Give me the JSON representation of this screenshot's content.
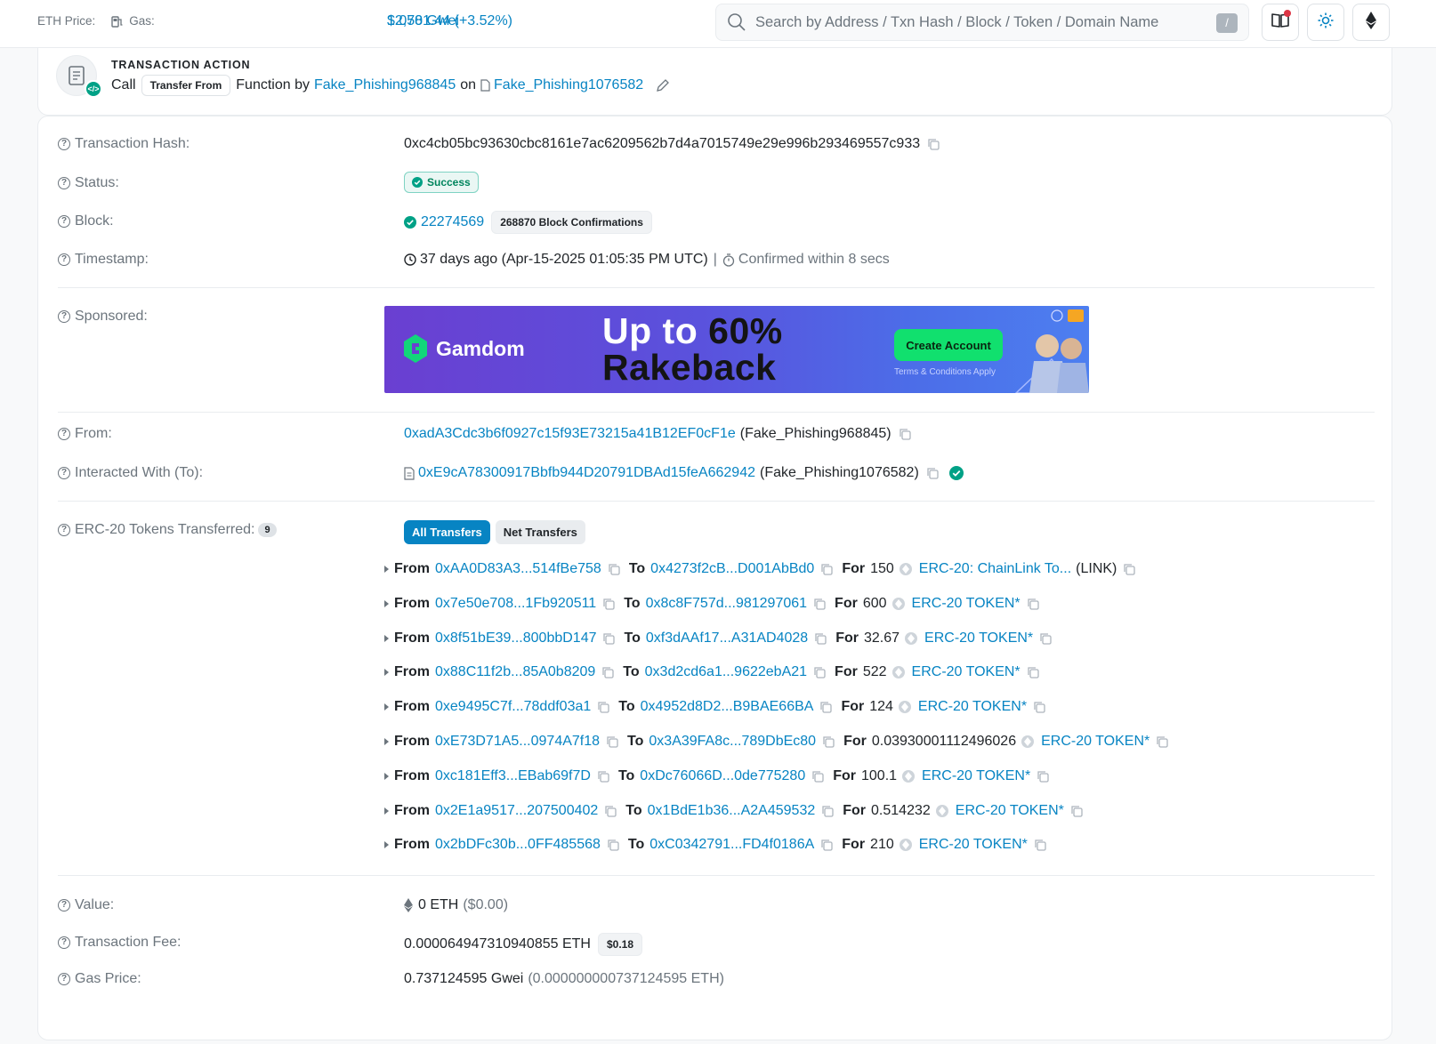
{
  "topbar": {
    "eth_price_label": "ETH Price:",
    "eth_price_value": "$2,701.44 (+3.52%)",
    "gas_label": "Gas:",
    "gas_value": "1.058 Gwei",
    "search_placeholder": "Search by Address / Txn Hash / Block / Token / Domain Name",
    "search_shortcut": "/"
  },
  "action": {
    "title": "TRANSACTION ACTION",
    "call": "Call",
    "method": "Transfer From",
    "function_by": "Function by",
    "from_name": "Fake_Phishing968845",
    "on": "on",
    "contract_name": "Fake_Phishing1076582"
  },
  "overview": {
    "hash_label": "Transaction Hash:",
    "hash": "0xc4cb05bc93630cbc8161e7ac6209562b7d4a7015749e29e996b293469557c933",
    "status_label": "Status:",
    "status": "Success",
    "block_label": "Block:",
    "block": "22274569",
    "confirmations": "268870 Block Confirmations",
    "timestamp_label": "Timestamp:",
    "timestamp": "37 days ago (Apr-15-2025 01:05:35 PM UTC)",
    "separator": "|",
    "confirmed": "Confirmed within 8 secs",
    "sponsored_label": "Sponsored:",
    "from_label": "From:",
    "from_address": "0xadA3Cdc3b6f0927c15f93E73215a41B12EF0cF1e",
    "from_name": "(Fake_Phishing968845)",
    "to_label": "Interacted With (To):",
    "to_address": "0xE9cA78300917Bbfb944D20791DBAd15feA662942",
    "to_name": "(Fake_Phishing1076582)",
    "erc20_label": "ERC-20 Tokens Transferred:",
    "erc20_count": "9",
    "tab_all": "All Transfers",
    "tab_net": "Net Transfers",
    "value_label": "Value:",
    "value": "0 ETH",
    "value_usd": "($0.00)",
    "fee_label": "Transaction Fee:",
    "fee": "0.000064947310940855 ETH",
    "fee_usd": "$0.18",
    "gas_price_label": "Gas Price:",
    "gas_price": "0.737124595 Gwei",
    "gas_price_eth": "(0.000000000737124595 ETH)"
  },
  "ad": {
    "brand": "Gamdom",
    "headline_1a": "Up to ",
    "headline_1b": "60%",
    "headline_2": "Rakeback",
    "cta": "Create Account",
    "terms": "Terms & Conditions Apply"
  },
  "transfers": [
    {
      "from_kw": "From",
      "from": "0xAA0D83A3...514fBe758",
      "to_kw": "To",
      "to": "0x4273f2cB...D001AbBd0",
      "for_kw": "For",
      "amount": "150",
      "token": "ERC-20: ChainLink To...",
      "symbol": "(LINK)"
    },
    {
      "from_kw": "From",
      "from": "0x7e50e708...1Fb920511",
      "to_kw": "To",
      "to": "0x8c8F757d...981297061",
      "for_kw": "For",
      "amount": "600",
      "token": "ERC-20 TOKEN*",
      "symbol": ""
    },
    {
      "from_kw": "From",
      "from": "0x8f51bE39...800bbD147",
      "to_kw": "To",
      "to": "0xf3dAAf17...A31AD4028",
      "for_kw": "For",
      "amount": "32.67",
      "token": "ERC-20 TOKEN*",
      "symbol": ""
    },
    {
      "from_kw": "From",
      "from": "0x88C11f2b...85A0b8209",
      "to_kw": "To",
      "to": "0x3d2cd6a1...9622ebA21",
      "for_kw": "For",
      "amount": "522",
      "token": "ERC-20 TOKEN*",
      "symbol": ""
    },
    {
      "from_kw": "From",
      "from": "0xe9495C7f...78ddf03a1",
      "to_kw": "To",
      "to": "0x4952d8D2...B9BAE66BA",
      "for_kw": "For",
      "amount": "124",
      "token": "ERC-20 TOKEN*",
      "symbol": ""
    },
    {
      "from_kw": "From",
      "from": "0xE73D71A5...0974A7f18",
      "to_kw": "To",
      "to": "0x3A39FA8c...789DbEc80",
      "for_kw": "For",
      "amount": "0.03930001112496026",
      "token": "ERC-20 TOKEN*",
      "symbol": ""
    },
    {
      "from_kw": "From",
      "from": "0xc181Eff3...EBab69f7D",
      "to_kw": "To",
      "to": "0xDc76066D...0de775280",
      "for_kw": "For",
      "amount": "100.1",
      "token": "ERC-20 TOKEN*",
      "symbol": ""
    },
    {
      "from_kw": "From",
      "from": "0x2E1a9517...207500402",
      "to_kw": "To",
      "to": "0x1BdE1b36...A2A459532",
      "for_kw": "For",
      "amount": "0.514232",
      "token": "ERC-20 TOKEN*",
      "symbol": ""
    },
    {
      "from_kw": "From",
      "from": "0x2bDFc30b...0FF485568",
      "to_kw": "To",
      "to": "0xC0342791...FD4f0186A",
      "for_kw": "For",
      "amount": "210",
      "token": "ERC-20 TOKEN*",
      "symbol": ""
    }
  ],
  "colors": {
    "link": "#0784c3",
    "success": "#00a186",
    "muted": "#6c757d"
  }
}
